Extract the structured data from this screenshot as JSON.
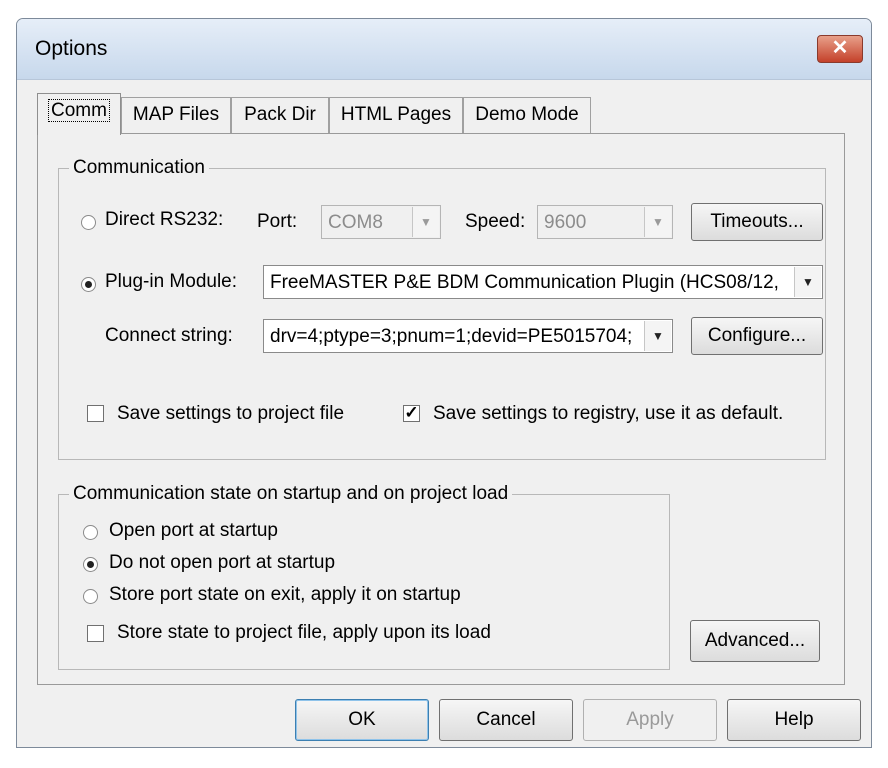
{
  "window": {
    "title": "Options",
    "close_glyph": "✕"
  },
  "tabs": [
    {
      "label": "Comm",
      "active": true
    },
    {
      "label": "MAP Files"
    },
    {
      "label": "Pack Dir"
    },
    {
      "label": "HTML Pages"
    },
    {
      "label": "Demo Mode"
    }
  ],
  "communication": {
    "legend": "Communication",
    "direct_label": "Direct RS232:",
    "port_label": "Port:",
    "port_value": "COM8",
    "speed_label": "Speed:",
    "speed_value": "9600",
    "timeouts_label": "Timeouts...",
    "plugin_label": "Plug-in Module:",
    "plugin_value": "FreeMASTER P&E BDM Communication Plugin (HCS08/12,",
    "connect_label": "Connect string:",
    "connect_value": "drv=4;ptype=3;pnum=1;devid=PE5015704;",
    "configure_label": "Configure...",
    "save_project_label": "Save settings to project file",
    "save_registry_label": "Save settings to registry, use it as default.",
    "check_glyph": "✓",
    "arrow_glyph": "▼"
  },
  "startup": {
    "legend": "Communication state on startup and on project load",
    "open_label": "Open port at startup",
    "no_open_label": "Do not open port at startup",
    "store_label": "Store port state on exit, apply it on startup",
    "store_project_label": "Store state to project file, apply upon its load"
  },
  "buttons": {
    "advanced": "Advanced...",
    "ok": "OK",
    "cancel": "Cancel",
    "apply": "Apply",
    "help": "Help"
  }
}
